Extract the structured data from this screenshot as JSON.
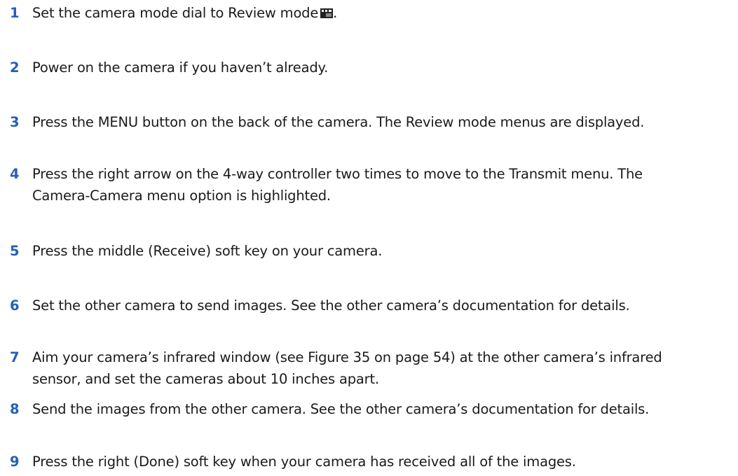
{
  "steps": [
    {
      "number": "1",
      "text": "Set the camera mode dial to Review mode",
      "suffix": ".",
      "icon": "review-mode-icon"
    },
    {
      "number": "2",
      "text": "Power on the camera if you haven’t already."
    },
    {
      "number": "3",
      "text": "Press the MENU button on the back of the camera. The Review mode menus are displayed."
    },
    {
      "number": "4",
      "text": "Press the right arrow on the 4-way controller two times to move to the Transmit menu. The\nCamera-Camera menu option is highlighted."
    },
    {
      "number": "5",
      "text": "Press the middle (Receive) soft key on your camera."
    },
    {
      "number": "6",
      "text": "Set the other camera to send images. See the other camera’s documentation for details."
    },
    {
      "number": "7",
      "text": "Aim your camera’s infrared window (see Figure 35 on page 54) at the other camera’s infrared\nsensor, and set the cameras about 10 inches apart."
    },
    {
      "number": "8",
      "text": "Send the images from the other camera. See the other camera’s documentation for details."
    },
    {
      "number": "9",
      "text": "Press the right (Done) soft key when your camera has received all of the images."
    }
  ],
  "colors": {
    "step_number": "#2460b8",
    "body_text": "#1a1a1a"
  }
}
